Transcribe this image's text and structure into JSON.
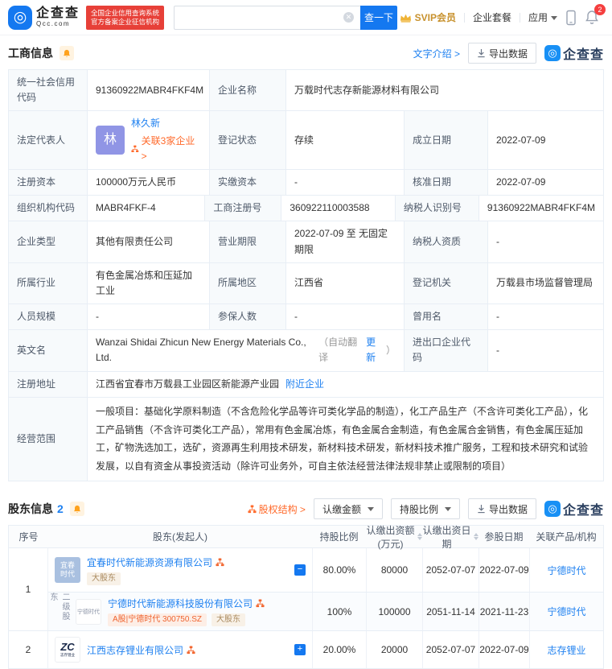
{
  "header": {
    "logo_name": "企查查",
    "logo_domain": "Qcc.com",
    "badge_line1": "全国企业信用查询系统",
    "badge_line2": "官方备案企业征信机构",
    "search_placeholder": "",
    "search_button": "查一下",
    "nav_svip": "SVIP会员",
    "nav_plan": "企业套餐",
    "nav_apps": "应用",
    "notification_count": "2"
  },
  "colors": {
    "primary_blue": "#1478F0",
    "link_blue": "#1E80F0",
    "orange": "#FF6A2B",
    "badge_red": "#E74038",
    "gold": "#EFB336"
  },
  "biz": {
    "title": "工商信息",
    "text_intro": "文字介绍 >",
    "export_label": "导出数据",
    "watermark": "企查查",
    "r1": {
      "l1": "统一社会信用代码",
      "v1": "91360922MABR4FKF4M",
      "l2": "企业名称",
      "v2": "万载时代志存新能源材料有限公司"
    },
    "r2": {
      "l1": "法定代表人",
      "avatar": "林",
      "person": "林久新",
      "related": "关联3家企业 >",
      "l2": "登记状态",
      "v2": "存续",
      "l3": "成立日期",
      "v3": "2022-07-09"
    },
    "r3": {
      "l1": "注册资本",
      "v1": "100000万元人民币",
      "l2": "实缴资本",
      "v2": "-",
      "l3": "核准日期",
      "v3": "2022-07-09"
    },
    "r4": {
      "l1": "组织机构代码",
      "v1": "MABR4FKF-4",
      "l2": "工商注册号",
      "v2": "360922110003588",
      "l3": "纳税人识别号",
      "v3": "91360922MABR4FKF4M"
    },
    "r5": {
      "l1": "企业类型",
      "v1": "其他有限责任公司",
      "l2": "营业期限",
      "v2": "2022-07-09 至 无固定期限",
      "l3": "纳税人资质",
      "v3": "-"
    },
    "r6": {
      "l1": "所属行业",
      "v1": "有色金属冶炼和压延加工业",
      "l2": "所属地区",
      "v2": "江西省",
      "l3": "登记机关",
      "v3": "万载县市场监督管理局"
    },
    "r7": {
      "l1": "人员规模",
      "v1": "-",
      "l2": "参保人数",
      "v2": "-",
      "l3": "曾用名",
      "v3": "-"
    },
    "r8": {
      "l1": "英文名",
      "v1": "Wanzai Shidai Zhicun New Energy Materials Co., Ltd.",
      "note_open": "（自动翻译",
      "update": "更新",
      "note_close": "）",
      "l2": "进出口企业代码",
      "v2": "-"
    },
    "r9": {
      "l1": "注册地址",
      "v1": "江西省宜春市万载县工业园区新能源产业园",
      "nearby": "附近企业"
    },
    "r10": {
      "l1": "经营范围",
      "v1": "一般项目：基础化学原料制造（不含危险化学品等许可类化学品的制造），化工产品生产（不含许可类化工产品），化工产品销售（不含许可类化工产品），常用有色金属冶炼，有色金属合金制造，有色金属合金销售，有色金属压延加工，矿物洗选加工，选矿，资源再生利用技术研发，新材料技术研发，新材料技术推广服务，工程和技术研究和试验发展，以自有资金从事投资活动（除许可业务外，可自主依法经营法律法规非禁止或限制的项目）"
    }
  },
  "shareholders": {
    "title": "股东信息",
    "count": "2",
    "equity_structure": "股权结构 >",
    "btn_amount": "认缴金额",
    "btn_ratio": "持股比例",
    "export_label": "导出数据",
    "watermark": "企查查",
    "headers": [
      "序号",
      "股东(发起人)",
      "持股比例",
      "认缴出资额(万元)",
      "认缴出资日期",
      "参股日期",
      "关联产品/机构"
    ],
    "row1": {
      "no": "1",
      "avatar_line1": "宜春",
      "avatar_line2": "时代",
      "name": "宜春时代新能源资源有限公司",
      "tag": "大股东",
      "collapse": "−",
      "ratio": "80.00%",
      "amount": "80000",
      "due_date": "2052-07-07",
      "join_date": "2022-07-09",
      "product": "宁德时代"
    },
    "row1_sub": {
      "level": "二级股东",
      "logo_text": "宁德时代",
      "name": "宁德时代新能源科技股份有限公司",
      "tag1": "A股|宁德时代 300750.SZ",
      "tag2": "大股东",
      "ratio": "100%",
      "amount": "100000",
      "due_date": "2051-11-14",
      "join_date": "2021-11-23",
      "product": "宁德时代"
    },
    "row2": {
      "no": "2",
      "logo_mark": "ZC",
      "logo_sub": "志存锂业",
      "name": "江西志存锂业有限公司",
      "expand": "+",
      "ratio": "20.00%",
      "amount": "20000",
      "due_date": "2052-07-07",
      "join_date": "2022-07-09",
      "product": "志存锂业"
    }
  }
}
